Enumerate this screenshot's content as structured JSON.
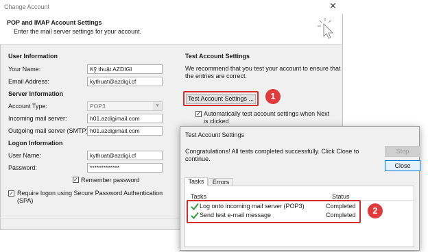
{
  "window": {
    "title": "Change Account",
    "close_glyph": "✕"
  },
  "header": {
    "title": "POP and IMAP Account Settings",
    "subtitle": "Enter the mail server settings for your account."
  },
  "user_info": {
    "heading": "User Information",
    "your_name_label": "Your Name:",
    "your_name_value": "Kỹ thuật AZDIGI",
    "email_label": "Email Address:",
    "email_value": "kythuat@azdigi.cf"
  },
  "server_info": {
    "heading": "Server Information",
    "account_type_label": "Account Type:",
    "account_type_value": "POP3",
    "incoming_label": "Incoming mail server:",
    "incoming_value": "h01.azdigimail.com",
    "outgoing_label": "Outgoing mail server (SMTP):",
    "outgoing_value": "h01.azdigimail.com"
  },
  "logon_info": {
    "heading": "Logon Information",
    "username_label": "User Name:",
    "username_value": "kythuat@azdigi.cf",
    "password_label": "Password:",
    "password_value": "*************",
    "remember_label": "Remember password",
    "remember_checked": true,
    "spa_label_line1": "Require logon using Secure Password Authentication",
    "spa_label_line2": "(SPA)",
    "spa_checked": true
  },
  "test_settings": {
    "heading": "Test Account Settings",
    "description_line1": "We recommend that you test your account to ensure that",
    "description_line2": "the entries are correct.",
    "button_label": "Test Account Settings ...",
    "auto_test_line1": "Automatically test account settings when Next",
    "auto_test_line2": "is clicked",
    "auto_test_checked": true
  },
  "dialog": {
    "title": "Test Account Settings",
    "message_line1": "Congratulations! All tests completed successfully. Click Close to",
    "message_line2": "continue.",
    "stop_label": "Stop",
    "close_label": "Close",
    "tabs": [
      "Tasks",
      "Errors"
    ],
    "columns": {
      "tasks": "Tasks",
      "status": "Status"
    },
    "rows": [
      {
        "task": "Log onto incoming mail server (POP3)",
        "status": "Completed"
      },
      {
        "task": "Send test e-mail message",
        "status": "Completed"
      }
    ]
  },
  "annotations": {
    "badge1": "1",
    "badge2": "2",
    "highlight_color": "#d82a2a"
  },
  "colors": {
    "check_green": "#2e9e3a",
    "window_bg": "#f0f0f0"
  }
}
